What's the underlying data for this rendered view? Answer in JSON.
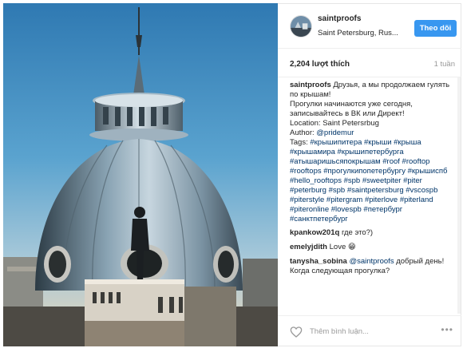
{
  "post": {
    "username": "saintproofs",
    "location": "Saint Petersburg, Rus...",
    "follow_label": "Theo dõi",
    "likes": "2,204 lượt thích",
    "time": "1 tuần"
  },
  "caption": {
    "username": "saintproofs",
    "line1": "Друзья, а мы продолжаем гулять по крышам!",
    "line2": "Прогулки начинаются уже сегодня, записывайтесь в ВК или Директ!",
    "line3": "Location: Saint Petersrbug",
    "line4_prefix": "Author: ",
    "author_link": "@pridemur",
    "tags_prefix": "Tags: ",
    "tags": "#крышипитера #крыши #крыша #крышамира #крышипетербурга #атышаришьсяпокрышам #roof #rooftop #rooftops #прогулкипопетербургу #крышиспб #hello_rooftops #spb #sweetpiter #piter #peterburg #spb #saintpetersburg #vscospb #piterstyle #pitergram #piterlove #piterland #piteronline #lovespb #петербург #санктпетербург"
  },
  "comments": [
    {
      "username": "kpankow201q",
      "text": "где это?)"
    },
    {
      "username": "emelyjdith",
      "text": "Love 😁"
    },
    {
      "username": "tanysha_sobina",
      "mention": "@saintproofs",
      "text": "добрый день! Когда следующая прогулка?"
    }
  ],
  "footer": {
    "placeholder": "Thêm bình luận...",
    "more": "•••"
  },
  "icons": {
    "heart": "heart-icon",
    "more": "more-options-icon"
  },
  "colors": {
    "accent": "#3897f0",
    "link": "#003569",
    "muted": "#999999"
  }
}
